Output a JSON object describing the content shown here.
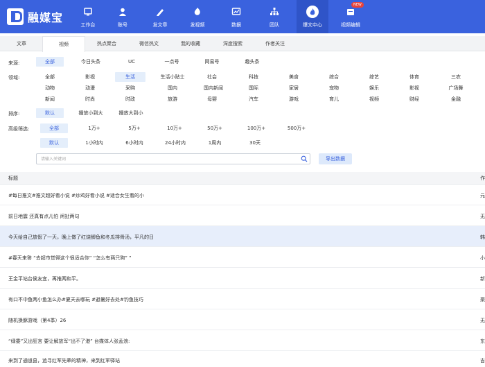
{
  "app": {
    "brand": "融媒宝"
  },
  "nav": [
    {
      "label": "工作台",
      "icon": "dashboard-icon"
    },
    {
      "label": "账号",
      "icon": "user-icon"
    },
    {
      "label": "发文章",
      "icon": "pen-icon"
    },
    {
      "label": "发视频",
      "icon": "video-icon"
    },
    {
      "label": "数据",
      "icon": "chart-icon"
    },
    {
      "label": "团队",
      "icon": "team-icon"
    },
    {
      "label": "爆文中心",
      "icon": "fire-icon",
      "active": true
    },
    {
      "label": "视频编辑",
      "icon": "video-edit-icon",
      "badge": "NEW"
    }
  ],
  "tabs": [
    "文章",
    "视频",
    "热点聚合",
    "微信热文",
    "我的收藏",
    "深度搜索",
    "作者关注"
  ],
  "filters": {
    "source_label": "来源:",
    "sources": [
      "全部",
      "今日头条",
      "UC",
      "一点号",
      "网易号",
      "趣头条"
    ],
    "field_label": "领域:",
    "fields_row1": [
      "全部",
      "影视",
      "生活",
      "生活小贴士",
      "社会",
      "科技",
      "美食",
      "综合",
      "综艺",
      "体育",
      "三农"
    ],
    "fields_row2": [
      "动物",
      "动漫",
      "采购",
      "国内",
      "国内新闻",
      "国际",
      "家居",
      "宠物",
      "娱乐",
      "影视",
      "广场舞"
    ],
    "fields_row3": [
      "新闻",
      "时尚",
      "时政",
      "旅游",
      "母婴",
      "汽车",
      "游戏",
      "育儿",
      "视频",
      "财经",
      "金融"
    ],
    "sort_label": "排序:",
    "sorts": [
      "默认",
      "播放小到大",
      "播放大到小"
    ],
    "advanced_label": "高级筛选:",
    "plays": [
      "全部",
      "1万+",
      "5万+",
      "10万+",
      "50万+",
      "100万+",
      "500万+"
    ],
    "times": [
      "默认",
      "1小时内",
      "6小时内",
      "24小时内",
      "1周内",
      "30天"
    ]
  },
  "search": {
    "placeholder": "请输入关键词"
  },
  "export_label": "导出数据",
  "table": {
    "col_title": "标题",
    "col_author": "作",
    "rows": [
      {
        "title": "#每日推文#推文超好看小说 #炒鸡好看小说 #适合女生看的小",
        "author": "元"
      },
      {
        "title": "前日地震 还真有点儿怕 闲扯两句",
        "author": "无"
      },
      {
        "title": "今天给自己放假了一天，晚上做了红烧鲫鱼和冬瓜排骨汤，平凡的日",
        "author": "韩"
      },
      {
        "title": "#春天来答  “去超市觉得这个很适合你”  “怎么有两只狗”  ”",
        "author": "小"
      },
      {
        "title": "王金平站台侯友宜，再推两和平。",
        "author": "新"
      },
      {
        "title": "有口不中鱼两小鱼怎么办#夏天去哪玩 #避暑好去处#钓鱼技巧",
        "author": "渠"
      },
      {
        "title": "随机换豚游戏（第4季）26",
        "author": "无"
      },
      {
        "title": "“绿委”又出狂言 要让解放军“出不了港” 台媒体人张孟浪:",
        "author": "东"
      },
      {
        "title": "来到了通道县，追寻红军先辈的精神，来到红军驿站",
        "author": "吉"
      }
    ]
  },
  "colors": {
    "primary": "#3a62de",
    "highlight_row": "#e7eefb",
    "selected_chip": "#e4eefb"
  }
}
